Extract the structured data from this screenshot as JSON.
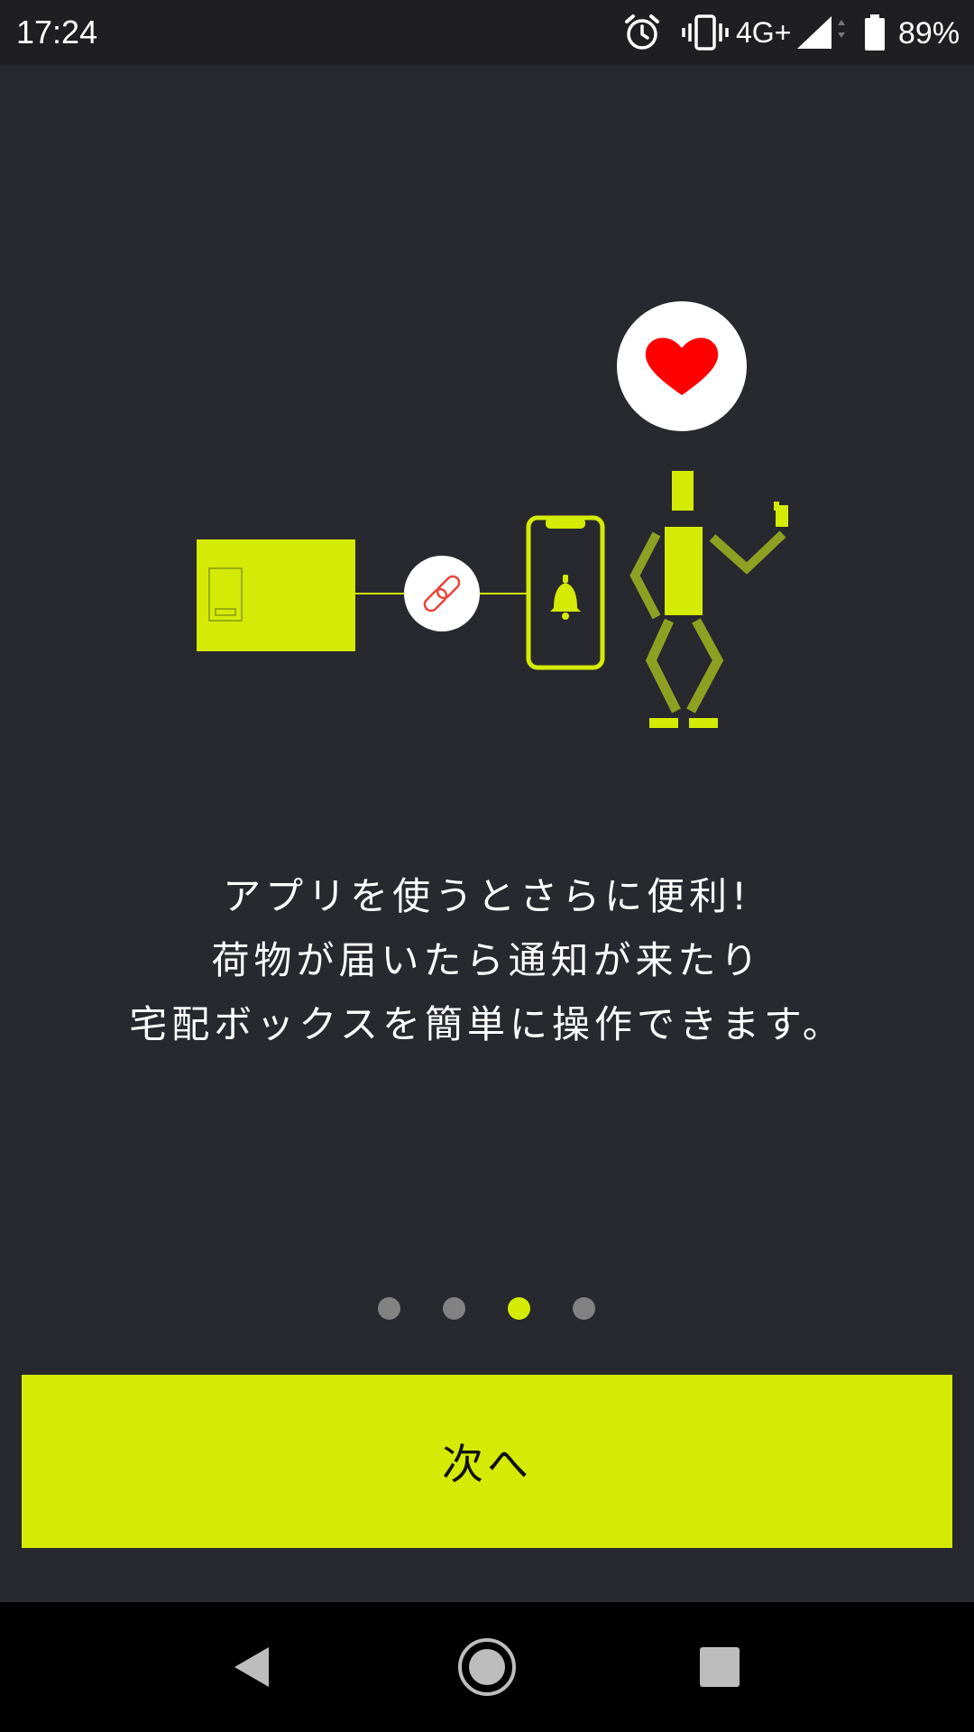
{
  "status_bar": {
    "time": "17:24",
    "network": "4G+",
    "battery": "89%",
    "icons": [
      "alarm-icon",
      "vibrate-icon",
      "signal-icon",
      "battery-icon"
    ]
  },
  "illustration": {
    "icons": [
      "delivery-box-icon",
      "link-icon",
      "smartphone-bell-icon",
      "person-icon",
      "heart-icon"
    ]
  },
  "message": {
    "lines": [
      "アプリを使うとさらに便利!",
      "荷物が届いたら通知が来たり",
      "宅配ボックスを簡単に操作できます。"
    ]
  },
  "pager": {
    "total": 4,
    "current_index": 2
  },
  "primary_button": {
    "label": "次へ"
  },
  "nav_bar": {
    "icons": [
      "back-icon",
      "home-icon",
      "recents-icon"
    ]
  },
  "colors": {
    "background": "#28292e",
    "accent": "#d4eb05",
    "person_dark": "#8ea022",
    "dot_inactive": "#828282",
    "heart": "#ff0000",
    "link": "#e8453c"
  }
}
